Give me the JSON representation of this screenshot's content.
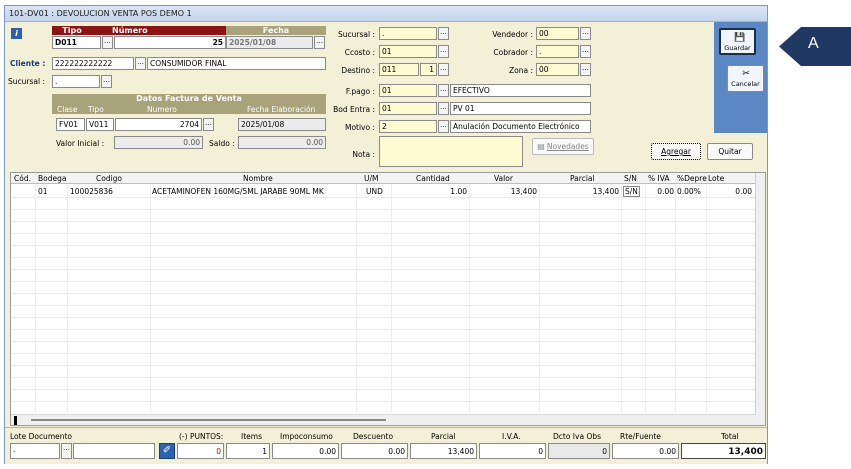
{
  "window": {
    "title": "101-DV01 : DEVOLUCION VENTA POS DEMO 1"
  },
  "doc": {
    "tipo_label": "Tipo",
    "numero_label": "Número",
    "fecha_label": "Fecha",
    "tipo": "D011",
    "numero": "25",
    "fecha": "2025/01/08",
    "cliente_label": "Cliente :",
    "cliente_code": "222222222222",
    "cliente_name": "CONSUMIDOR FINAL",
    "sucursal_label": "Sucursal :",
    "sucursal": "."
  },
  "datos_factura": {
    "title": "Datos Factura de Venta",
    "clase_label": "Clase",
    "tipo_label": "Tipo",
    "numero_label": "Numero",
    "fecha_label": "Fecha Elaboración",
    "clase": "FV01",
    "tipo": "V011",
    "numero": "2704",
    "fecha": "2025/01/08",
    "valor_inicial_label": "Valor Inicial :",
    "valor_inicial": "0.00",
    "saldo_label": "Saldo :",
    "saldo": "0.00"
  },
  "mid": {
    "sucursal_label": "Sucursal :",
    "sucursal": ".",
    "ccosto_label": "Ccosto :",
    "ccosto": "01",
    "destino_label": "Destino :",
    "destino": "011",
    "destino_num": "1",
    "vendedor_label": "Vendedor :",
    "vendedor": "00",
    "cobrador_label": "Cobrador :",
    "cobrador": ".",
    "zona_label": "Zona :",
    "zona": "00",
    "fpago_label": "F.pago :",
    "fpago": "01",
    "fpago_desc": "EFECTIVO",
    "bodentra_label": "Bod Entra :",
    "bodentra": "01",
    "bodentra_desc": "PV 01",
    "motivo_label": "Motivo :",
    "motivo": "2",
    "motivo_desc": "Anulación Documento Electrónico",
    "nota_label": "Nota :",
    "novedades_label": "Novedades"
  },
  "actions": {
    "guardar": "Guardar",
    "cancelar": "Cancelar",
    "agregar": "Agregar",
    "quitar": "Quitar"
  },
  "grid": {
    "headers": [
      "Cód.",
      "Bodega",
      "Codigo",
      "Nombre",
      "U/M",
      "Cantidad",
      "Valor",
      "Parcial",
      "S/N",
      "% IVA",
      "%Depre",
      "Lote"
    ],
    "row": {
      "cod": "",
      "bodega": "01",
      "codigo": "100025836",
      "nombre": "ACETAMINOFEN 160MG/5ML JARABE 90ML MK",
      "um": "UND",
      "cantidad": "1.00",
      "valor": "13,400",
      "parcial": "13,400",
      "sn": "S/N",
      "iva": "0.00",
      "depre": "0.00%",
      "lote": "0.00"
    }
  },
  "footer": {
    "lote_doc_label": "Lote Documento",
    "lote_doc": ".",
    "puntos_label": "(-) PUNTOS:",
    "puntos": "0",
    "items_label": "Items",
    "items": "1",
    "impoconsumo_label": "Impoconsumo",
    "impoconsumo": "0.00",
    "descuento_label": "Descuento",
    "descuento": "0.00",
    "parcial_label": "Parcial",
    "parcial": "13,400",
    "iva_label": "I.V.A.",
    "iva": "0",
    "dcto_label": "Dcto Iva Obs",
    "dcto": "0",
    "rte_label": "Rte/Fuente",
    "rte": "0.00",
    "total_label": "Total",
    "total": "13,400"
  },
  "callout": {
    "label": "A"
  }
}
